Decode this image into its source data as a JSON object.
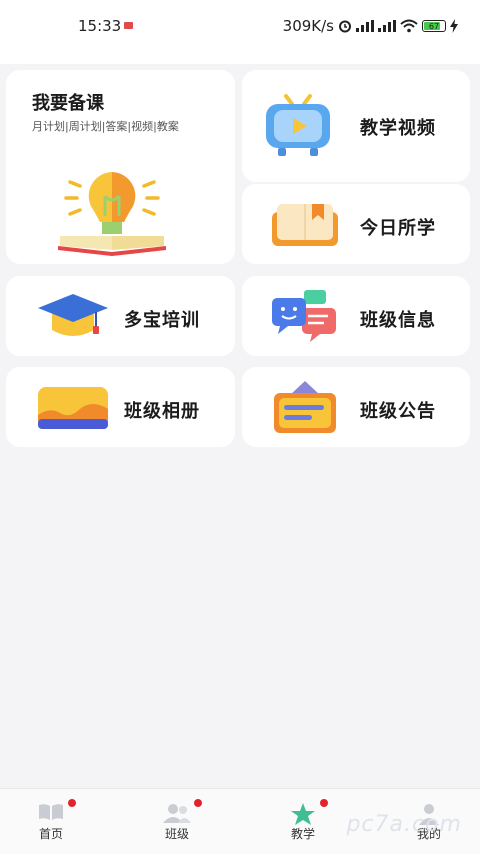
{
  "status_bar": {
    "time": "15:33",
    "network_speed": "309K/s",
    "battery": "67"
  },
  "cards": {
    "prep": {
      "title": "我要备课",
      "subtitle": "月计划|周计划|答案|视频|教案"
    },
    "teaching_video": {
      "label": "教学视频"
    },
    "today_learned": {
      "label": "今日所学"
    },
    "training": {
      "label": "多宝培训"
    },
    "class_info": {
      "label": "班级信息"
    },
    "class_album": {
      "label": "班级相册"
    },
    "class_notice": {
      "label": "班级公告"
    }
  },
  "tabbar": {
    "items": [
      {
        "label": "首页",
        "icon": "book-icon",
        "badge": true
      },
      {
        "label": "班级",
        "icon": "people-icon",
        "badge": true
      },
      {
        "label": "教学",
        "icon": "star-icon",
        "badge": true,
        "active": true
      },
      {
        "label": "我的",
        "icon": "person-icon",
        "badge": false
      }
    ]
  },
  "watermark": "pc7a.com",
  "colors": {
    "accent": "#3fbf8f",
    "badge": "#e0242b",
    "background": "#f4f4f6"
  }
}
